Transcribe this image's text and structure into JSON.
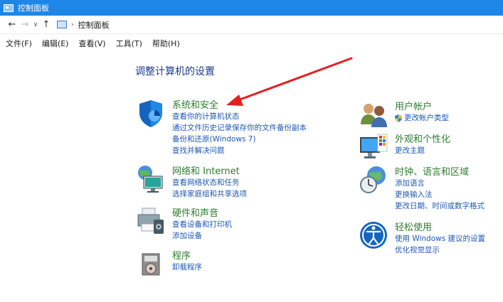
{
  "window": {
    "title": "控制面板"
  },
  "address": {
    "path": "控制面板"
  },
  "menu": [
    "文件(F)",
    "编辑(E)",
    "查看(V)",
    "工具(T)",
    "帮助(H)"
  ],
  "heading": "调整计算机的设置",
  "left_categories": [
    {
      "icon": "shield-icon",
      "title": "系统和安全",
      "links": [
        "查看你的计算机状态",
        "通过文件历史记录保存你的文件备份副本",
        "备份和还原(Windows 7)",
        "查找并解决问题"
      ]
    },
    {
      "icon": "network-globe-icon",
      "title": "网络和 Internet",
      "links": [
        "查看网络状态和任务",
        "选择家庭组和共享选项"
      ]
    },
    {
      "icon": "printer-icon",
      "title": "硬件和声音",
      "links": [
        "查看设备和打印机",
        "添加设备"
      ]
    },
    {
      "icon": "programs-icon",
      "title": "程序",
      "links": [
        "卸载程序"
      ]
    }
  ],
  "right_categories": [
    {
      "icon": "users-icon",
      "title": "用户帐户",
      "links": [
        "更改帐户类型"
      ]
    },
    {
      "icon": "display-palette-icon",
      "title": "外观和个性化",
      "links": [
        "更改主题"
      ]
    },
    {
      "icon": "clock-globe-icon",
      "title": "时钟、语言和区域",
      "links": [
        "添加语言",
        "更换输入法",
        "更改日期、时间或数字格式"
      ]
    },
    {
      "icon": "ease-of-access-icon",
      "title": "轻松使用",
      "links": [
        "使用 Windows 建议的设置",
        "优化视觉显示"
      ]
    }
  ],
  "colors": {
    "titlebar": "#1e86e6",
    "heading": "#1e3a8a",
    "category_title": "#2f7d32",
    "link": "#1e58b4",
    "annotation_arrow": "#e52020"
  }
}
